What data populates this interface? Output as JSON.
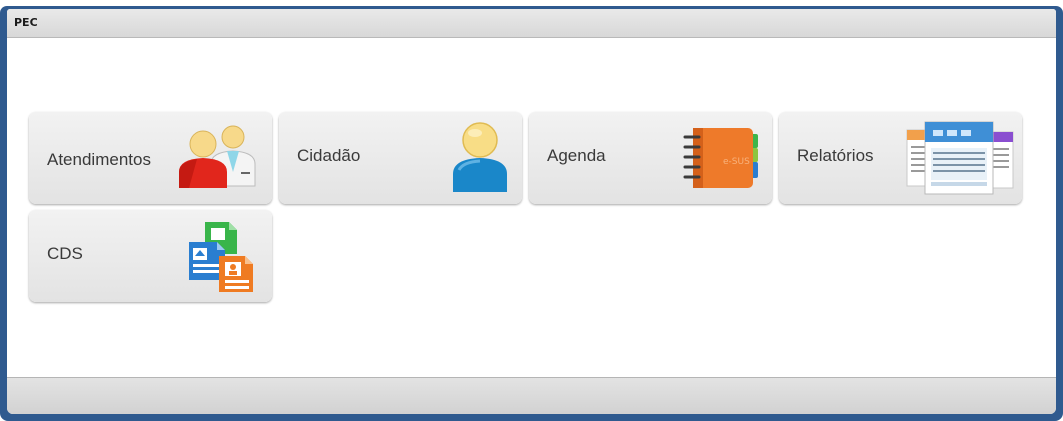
{
  "window": {
    "title": "PEC"
  },
  "tiles": [
    {
      "label": "Atendimentos",
      "icon": "people-icon"
    },
    {
      "label": "Cidadão",
      "icon": "user-icon"
    },
    {
      "label": "Agenda",
      "icon": "agenda-book-icon",
      "icon_text": "e-SUS"
    },
    {
      "label": "Relatórios",
      "icon": "reports-icon"
    },
    {
      "label": "CDS",
      "icon": "cds-forms-icon"
    }
  ],
  "colors": {
    "frame": "#2f5a8f",
    "tile_bg": "#ebebeb",
    "agenda_orange": "#ee7a2a",
    "user_blue": "#1a87c9"
  }
}
